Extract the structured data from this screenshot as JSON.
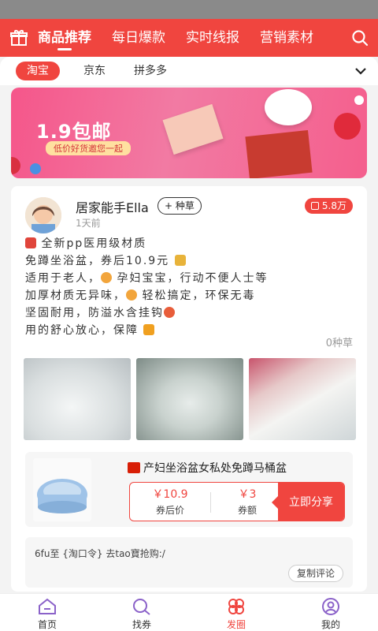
{
  "header": {
    "tabs": [
      {
        "label": "商品推荐",
        "active": true
      },
      {
        "label": "每日爆款",
        "active": false
      },
      {
        "label": "实时线报",
        "active": false
      },
      {
        "label": "营销素材",
        "active": false
      }
    ],
    "icons": {
      "left": "gift-icon",
      "right": "search-icon"
    }
  },
  "platforms": [
    "淘宝",
    "京东",
    "拼多多"
  ],
  "banner": {
    "title": "1.9包邮",
    "subtitle": "低价好货邀您一起"
  },
  "post": {
    "user": "居家能手Ella",
    "follow_label": "+ 种草",
    "time": "1天前",
    "share_count": "5.8万",
    "lines": [
      "全新pp医用级材质",
      "免蹲坐浴盆，券后10.9元",
      "适用于老人，",
      "孕妇宝宝，行动不便人士等",
      "加厚材质无异味，",
      "轻松搞定，环保无毒",
      "坚固耐用，防溢水含挂钩",
      "用的舒心放心，保障"
    ],
    "plant_count": "0种草"
  },
  "product": {
    "title": "产妇坐浴盆女私处免蹲马桶盆",
    "price": "￥10.9",
    "price_label": "券后价",
    "coupon": "￥3",
    "coupon_label": "券额",
    "share_button": "立即分享"
  },
  "comment": {
    "text": "6fu至 {淘口令} 去tao寶抢购:/",
    "copy_button": "复制评论"
  },
  "nav": [
    {
      "label": "首页",
      "icon": "home-icon"
    },
    {
      "label": "找券",
      "icon": "coupon-search-icon"
    },
    {
      "label": "发圈",
      "icon": "flower-icon"
    },
    {
      "label": "我的",
      "icon": "profile-icon"
    }
  ],
  "colors": {
    "accent": "#f0453f"
  }
}
